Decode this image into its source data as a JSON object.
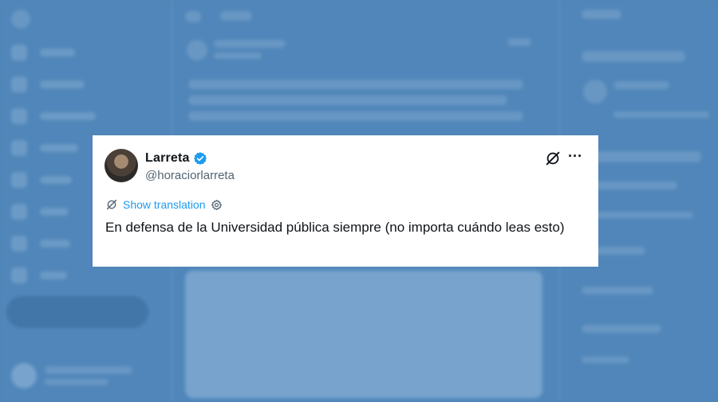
{
  "tweet": {
    "author_name": "Larreta",
    "handle": "@horaciorlarreta",
    "translate_label": "Show translation",
    "text": "En defensa de la Universidad pública siempre (no importa cuándo leas esto)"
  },
  "icons": {
    "avatar": "avatar",
    "verified": "verified-badge-icon",
    "grok": "grok-icon",
    "more": "more-options-icon",
    "translate": "translate-icon",
    "settings": "gear-icon"
  },
  "colors": {
    "accent": "#1d9bf0",
    "text": "#0f1419",
    "secondary": "#536471",
    "background_tint": "#4f85b8"
  }
}
